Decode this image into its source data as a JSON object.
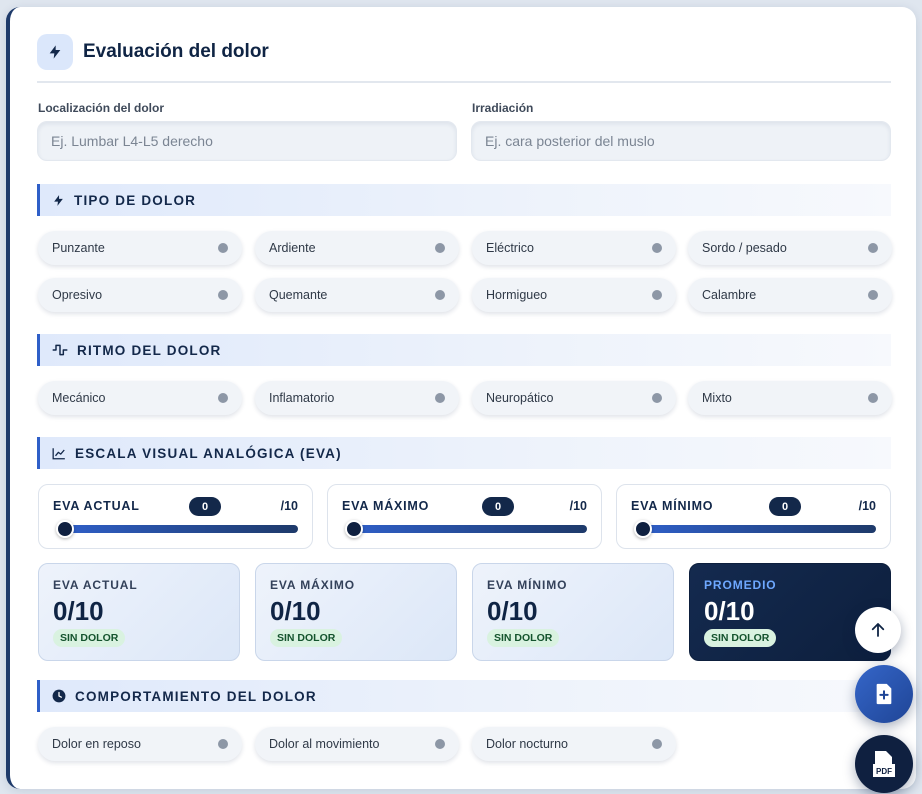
{
  "header": {
    "title": "Evaluación del dolor"
  },
  "fields": {
    "location": {
      "label": "Localización del dolor",
      "placeholder": "Ej. Lumbar L4-L5 derecho"
    },
    "irradiation": {
      "label": "Irradiación",
      "placeholder": "Ej. cara posterior del muslo"
    }
  },
  "sections": {
    "tipo": "TIPO DE DOLOR",
    "ritmo": "RITMO DEL DOLOR",
    "eva": "ESCALA VISUAL ANALÓGICA (EVA)",
    "comportamiento": "COMPORTAMIENTO DEL DOLOR"
  },
  "tipo_options": [
    "Punzante",
    "Ardiente",
    "Eléctrico",
    "Sordo / pesado",
    "Opresivo",
    "Quemante",
    "Hormigueo",
    "Calambre"
  ],
  "ritmo_options": [
    "Mecánico",
    "Inflamatorio",
    "Neuropático",
    "Mixto"
  ],
  "sliders": [
    {
      "label": "EVA ACTUAL",
      "value": "0",
      "max": "/10",
      "level": 0
    },
    {
      "label": "EVA MÁXIMO",
      "value": "0",
      "max": "/10",
      "level": 0
    },
    {
      "label": "EVA MÍNIMO",
      "value": "0",
      "max": "/10",
      "level": 0
    }
  ],
  "stats": [
    {
      "title": "EVA ACTUAL",
      "value": "0/10",
      "badge": "SIN DOLOR"
    },
    {
      "title": "EVA MÁXIMO",
      "value": "0/10",
      "badge": "SIN DOLOR"
    },
    {
      "title": "EVA MÍNIMO",
      "value": "0/10",
      "badge": "SIN DOLOR"
    },
    {
      "title": "PROMEDIO",
      "value": "0/10",
      "badge": "SIN DOLOR"
    }
  ],
  "comportamiento_options": [
    "Dolor en reposo",
    "Dolor al movimiento",
    "Dolor nocturno"
  ],
  "colors": {
    "accent": "#2f5fc8",
    "navy": "#13284a",
    "badge_bg": "#d9f2e0"
  },
  "icons": {
    "header": "bolt-icon",
    "tipo": "bolt-icon",
    "ritmo": "pulse-icon",
    "eva": "chart-line-icon",
    "comportamiento": "clock-icon",
    "fab_top": "arrow-up-icon",
    "fab_add": "file-plus-icon",
    "fab_pdf": "pdf-icon"
  },
  "fab": {
    "pdf_text": "PDF"
  }
}
